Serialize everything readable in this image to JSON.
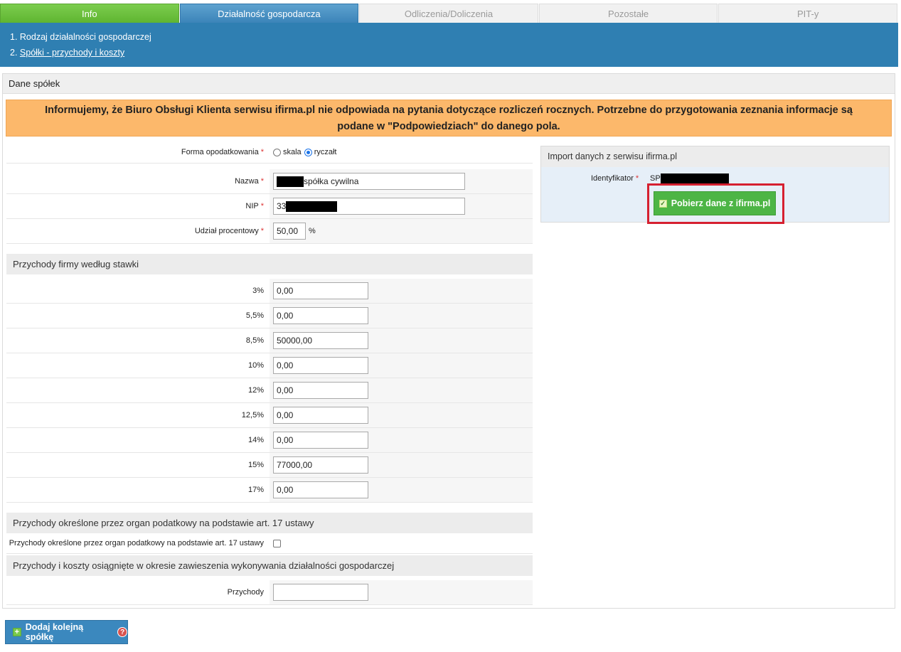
{
  "tabs": [
    {
      "label": "Info"
    },
    {
      "label": "Działalność gospodarcza"
    },
    {
      "label": "Odliczenia/Doliczenia"
    },
    {
      "label": "Pozostałe"
    },
    {
      "label": "PIT-y"
    }
  ],
  "steps": [
    {
      "label": "1. Rodzaj działalności gospodarczej"
    },
    {
      "prefix": "2. ",
      "label": "Spółki - przychody i koszty"
    }
  ],
  "panel": {
    "title": "Dane spółek"
  },
  "notice": {
    "line1": "Informujemy, że Biuro Obsługi Klienta serwisu ifirma.pl nie odpowiada na pytania dotyczące rozliczeń rocznych. Potrzebne do przygotowania zeznania informacje są",
    "line2": "podane w \"Podpowiedziach\" do danego pola."
  },
  "form": {
    "taxation": {
      "label": "Forma opodatkowania",
      "options": [
        "skala",
        "ryczałt"
      ],
      "selected": "ryczałt"
    },
    "name": {
      "label": "Nazwa",
      "value": "spółka cywilna"
    },
    "nip": {
      "label": "NIP",
      "value": "33"
    },
    "share": {
      "label": "Udział procentowy",
      "value": "50,00",
      "unit": "%"
    },
    "required_mark": "*"
  },
  "revenue": {
    "title": "Przychody firmy według stawki",
    "rates": [
      {
        "label": "3%",
        "value": "0,00"
      },
      {
        "label": "5,5%",
        "value": "0,00"
      },
      {
        "label": "8,5%",
        "value": "50000,00"
      },
      {
        "label": "10%",
        "value": "0,00"
      },
      {
        "label": "12%",
        "value": "0,00"
      },
      {
        "label": "12,5%",
        "value": "0,00"
      },
      {
        "label": "14%",
        "value": "0,00"
      },
      {
        "label": "15%",
        "value": "77000,00"
      },
      {
        "label": "17%",
        "value": "0,00"
      }
    ]
  },
  "art17": {
    "title": "Przychody określone przez organ podatkowy na podstawie art. 17 ustawy",
    "checkbox_label": "Przychody określone przez organ podatkowy na podstawie art. 17 ustawy",
    "checked": false
  },
  "suspension": {
    "title": "Przychody i koszty osiągnięte w okresie zawieszenia wykonywania działalności gospodarczej",
    "income_label": "Przychody",
    "income_value": ""
  },
  "import": {
    "title": "Import danych z serwisu ifirma.pl",
    "id_label": "Identyfikator",
    "id_value": "SP",
    "button_label": "Pobierz dane z ifirma.pl"
  },
  "add_company": {
    "label": "Dodaj kolejną spółkę",
    "help_icon": "?"
  },
  "colors": {
    "tab_info": "#5fb531",
    "tab_active": "#3b84b9",
    "steps_bar": "#2f7fb2",
    "notice_bg": "#fcb86b",
    "highlight": "#d62030",
    "green_button": "#4db545",
    "blue_button": "#3b88be"
  }
}
